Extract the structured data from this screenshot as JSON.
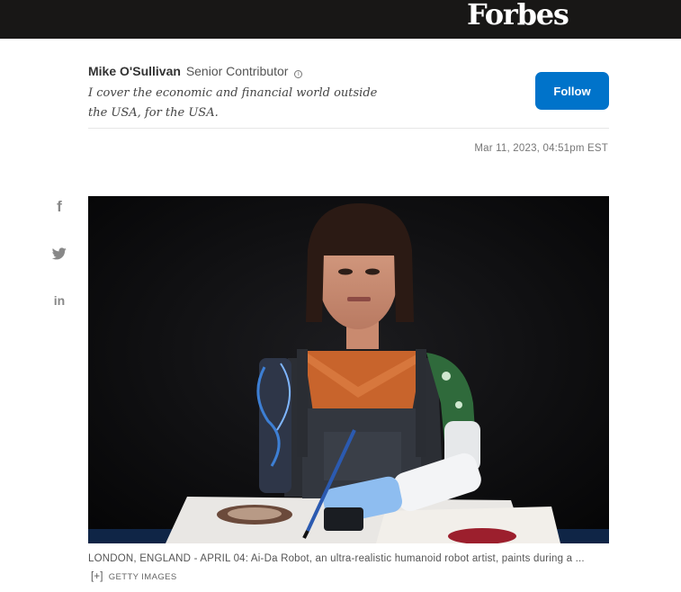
{
  "header": {
    "brand": "Forbes"
  },
  "author": {
    "name": "Mike O'Sullivan",
    "title": "Senior Contributor",
    "bio": "I cover the economic and financial world outside the USA, for the USA."
  },
  "follow_button": {
    "label": "Follow"
  },
  "article": {
    "date": "Mar 11, 2023, 04:51pm EST"
  },
  "share": [
    {
      "icon": "facebook-icon",
      "glyph": "f"
    },
    {
      "icon": "twitter-icon",
      "glyph": ""
    },
    {
      "icon": "linkedin-icon",
      "glyph": "in"
    }
  ],
  "image": {
    "caption": "LONDON, ENGLAND - APRIL 04: Ai-Da Robot, an ultra-realistic humanoid robot artist, paints during a ...",
    "expand": "[+]",
    "credit": "GETTY IMAGES"
  },
  "colors": {
    "header_bg": "#181716",
    "accent": "#0073ca"
  }
}
